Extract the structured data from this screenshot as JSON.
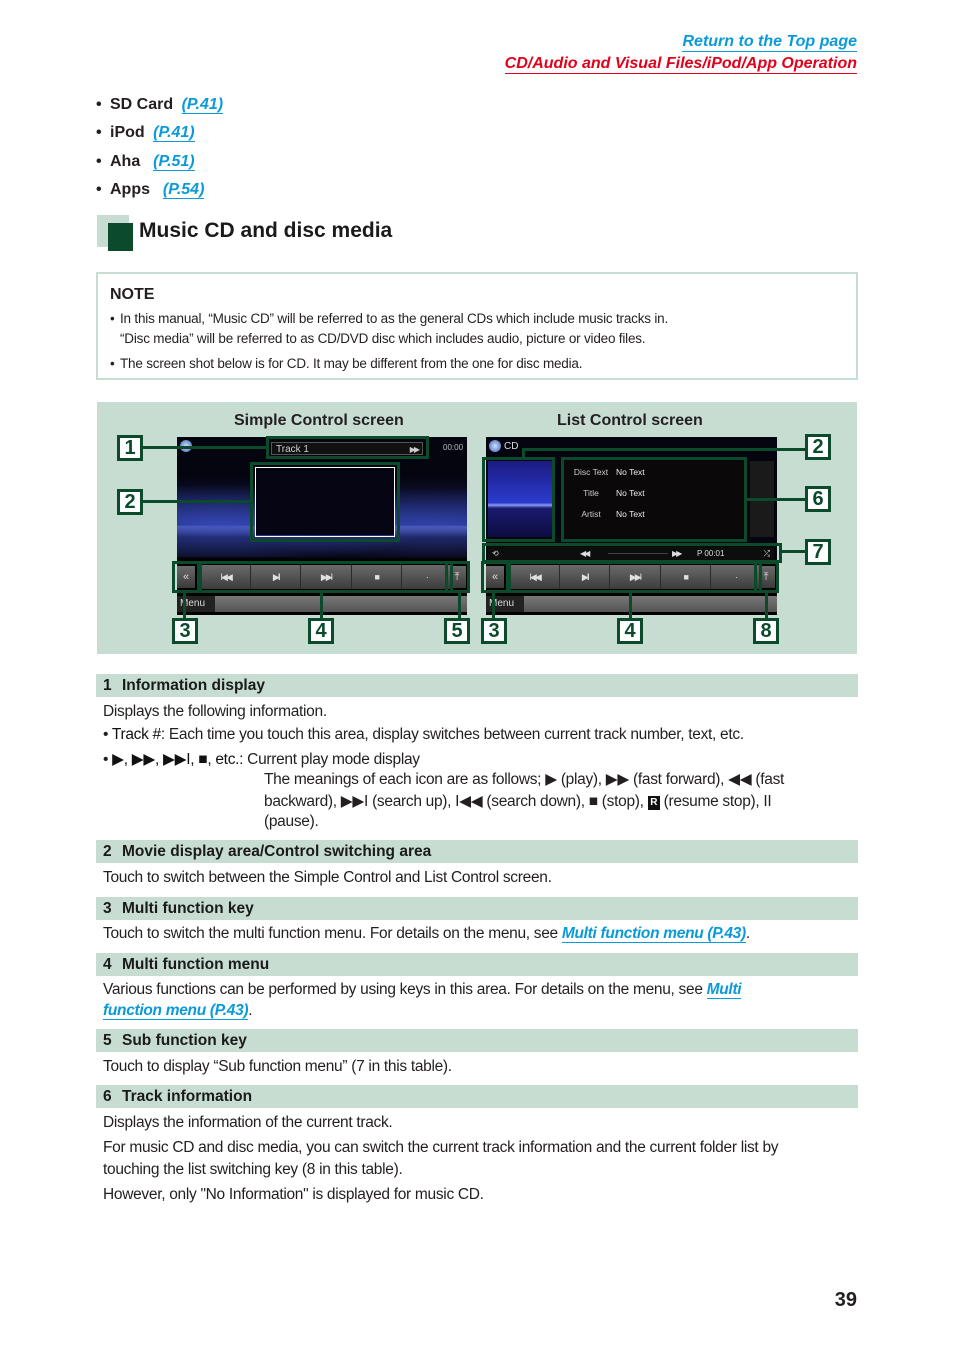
{
  "nav": {
    "top_link": "Return to the Top page",
    "section_link": "CD/Audio and Visual Files/iPod/App Operation"
  },
  "bullets": [
    {
      "label": "SD Card",
      "ref": "(P.41)"
    },
    {
      "label": "iPod",
      "ref": "(P.41)"
    },
    {
      "label": "Aha",
      "ref": "(P.51)"
    },
    {
      "label": "Apps",
      "ref": "(P.54)"
    }
  ],
  "section_title": "Music CD and disc media",
  "note": {
    "heading": "NOTE",
    "bullet": "•",
    "lines": [
      "In this manual, “Music CD” will be referred to as the general CDs which include music tracks in.",
      "“Disc media” will be referred to as CD/DVD disc which includes audio, picture or video files.",
      "The screen shot below is for CD. It may be different from the one for disc media."
    ]
  },
  "figure": {
    "simple": {
      "label": "Simple Control screen",
      "track": "Track 1",
      "track_icon": "▶▶",
      "time": "00:00",
      "controls": [
        "I◀◀",
        "▶II",
        "▶▶I",
        "■",
        "·"
      ],
      "left_key": "«",
      "right_key": "⤒",
      "menu": "Menu",
      "callouts": [
        "1",
        "2",
        "3",
        "4",
        "5"
      ]
    },
    "list": {
      "label": "List Control screen",
      "source": "CD",
      "fields": [
        {
          "key": "Disc Text",
          "value": "No Text"
        },
        {
          "key": "Title",
          "value": "No Text"
        },
        {
          "key": "Artist",
          "value": "No Text"
        }
      ],
      "sub_bar": {
        "repeat": "⟲",
        "rew": "◀◀",
        "ff": "▶▶",
        "time": "P 00:01",
        "random": "⤮"
      },
      "controls": [
        "I◀◀",
        "▶II",
        "▶▶I",
        "■",
        "·"
      ],
      "left_key": "«",
      "right_key": "⤒",
      "menu": "Menu",
      "callouts": [
        "2",
        "6",
        "7",
        "3",
        "4",
        "8"
      ]
    }
  },
  "items": [
    {
      "num": "1",
      "title": "Information display",
      "lines": {
        "intro": "Displays the following information.",
        "track_label": "Track #",
        "track_text": ": Each time you touch this area, display switches between current track number, text, etc.",
        "icons_label": "▶, ▶▶, ▶▶I, ■, etc.",
        "icons_text": ": Current play mode display",
        "meaning1": "The meanings of each icon are as follows; ▶ (play), ▶▶ (fast forward), ◀◀ (fast",
        "meaning2a": "backward), ▶▶I (search up), I◀◀ (search down), ■ (stop), ",
        "resume_icon": "R",
        "meaning2b": " (resume stop), II",
        "meaning3": "(pause)."
      }
    },
    {
      "num": "2",
      "title": "Movie display area/Control switching area",
      "text": "Touch to switch between the Simple Control and List Control screen."
    },
    {
      "num": "3",
      "title": "Multi function key",
      "text": "Touch to switch the multi function menu. For details on the menu, see ",
      "link": "Multi function menu (P.43)",
      "after": "."
    },
    {
      "num": "4",
      "title": "Multi function menu",
      "text": "Various functions can be performed by using keys in this area. For details on the menu, see ",
      "link1": "Multi",
      "link2": "function menu (P.43)",
      "after": "."
    },
    {
      "num": "5",
      "title": "Sub function key",
      "text": "Touch to display “Sub function menu” (7 in this table)."
    },
    {
      "num": "6",
      "title": "Track information",
      "lines": [
        "Displays the information of the current track.",
        "For music CD and disc media, you can switch the current track information and the current folder list by",
        "touching the list switching key (8 in this table).",
        "However, only \"No Information\" is displayed for music CD."
      ]
    }
  ],
  "page_number": "39"
}
